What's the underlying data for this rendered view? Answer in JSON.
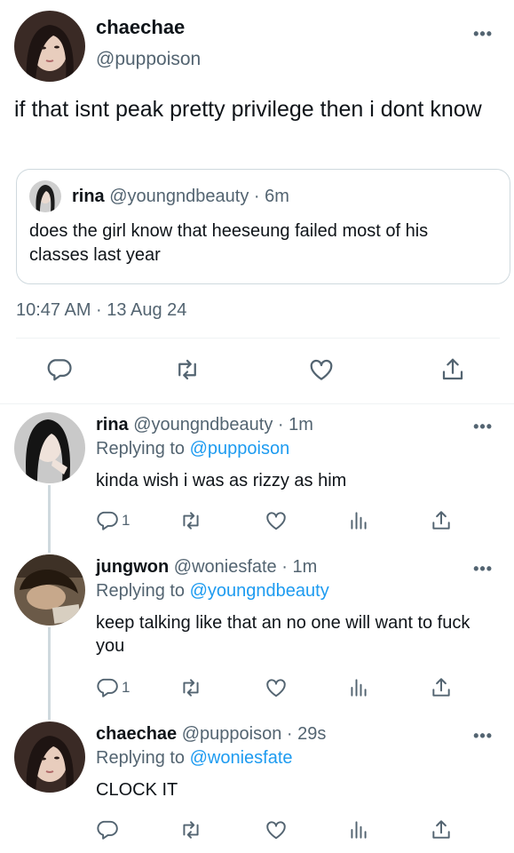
{
  "main_tweet": {
    "name": "chaechae",
    "handle": "@puppoison",
    "text": "if that isnt peak pretty privilege then i dont know",
    "timestamp": "10:47 AM · 13 Aug 24",
    "more": "•••"
  },
  "quoted_tweet": {
    "name": "rina",
    "handle": "@youngndbeauty",
    "time": "· 6m",
    "text": "does the girl know that heeseung failed most of his classes last year"
  },
  "replies": [
    {
      "name": "rina",
      "handle": "@youngndbeauty",
      "time": "· 1m",
      "replying_label": "Replying to",
      "replying_to": "@puppoison",
      "text": "kinda wish i was as rizzy as him",
      "reply_count": "1",
      "more": "•••"
    },
    {
      "name": "jungwon",
      "handle": "@woniesfate",
      "time": "· 1m",
      "replying_label": "Replying to",
      "replying_to": "@youngndbeauty",
      "text": "keep talking like that an no one will want to fuck you",
      "reply_count": "1",
      "more": "•••"
    },
    {
      "name": "chaechae",
      "handle": "@puppoison",
      "time": "· 29s",
      "replying_label": "Replying to",
      "replying_to": "@woniesfate",
      "text": "CLOCK IT",
      "reply_count": "",
      "more": "•••"
    }
  ],
  "icons": {
    "reply": "reply-icon",
    "retweet": "retweet-icon",
    "like": "heart-icon",
    "views": "views-icon",
    "share": "share-icon"
  },
  "colors": {
    "link": "#1d9bf0",
    "secondary_text": "#536471",
    "primary_text": "#0f1419",
    "border": "#cfd9de"
  }
}
